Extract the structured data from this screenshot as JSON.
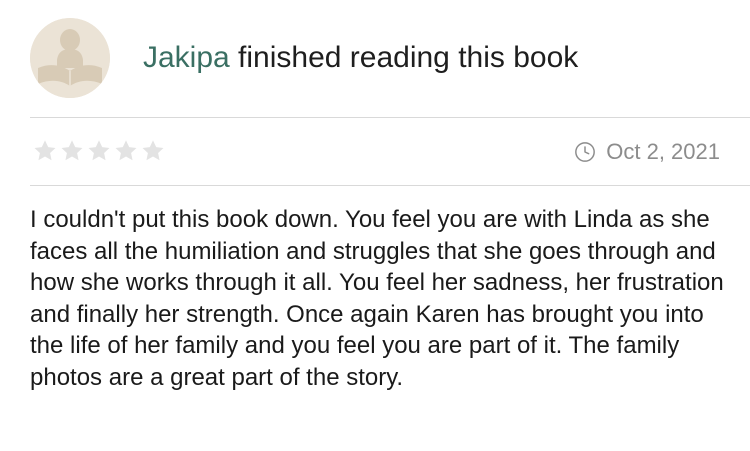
{
  "activity": {
    "username": "Jakipa",
    "action": " finished reading this book",
    "avatar_icon": "reader-silhouette-icon"
  },
  "rating": {
    "stars_total": 5,
    "stars_filled": 0,
    "star_icon": "star-icon",
    "empty_star_color": "#e3e3e3"
  },
  "meta": {
    "date": "Oct 2, 2021",
    "clock_icon": "clock-icon"
  },
  "review": {
    "text": "I couldn't put this book down. You feel you are with Linda as she faces all the humiliation and struggles that she goes through and how she works through it all. You feel her sadness, her frustration and finally her strength. Once again Karen has brought you into the life of her family and you feel you are part of it. The family photos are a great part of the story."
  },
  "colors": {
    "username": "#3a6f63",
    "muted_text": "#8c8c8c",
    "divider": "#d9d9d9",
    "avatar_bg": "#ebe3d6",
    "avatar_figure": "#d8cbb6"
  }
}
